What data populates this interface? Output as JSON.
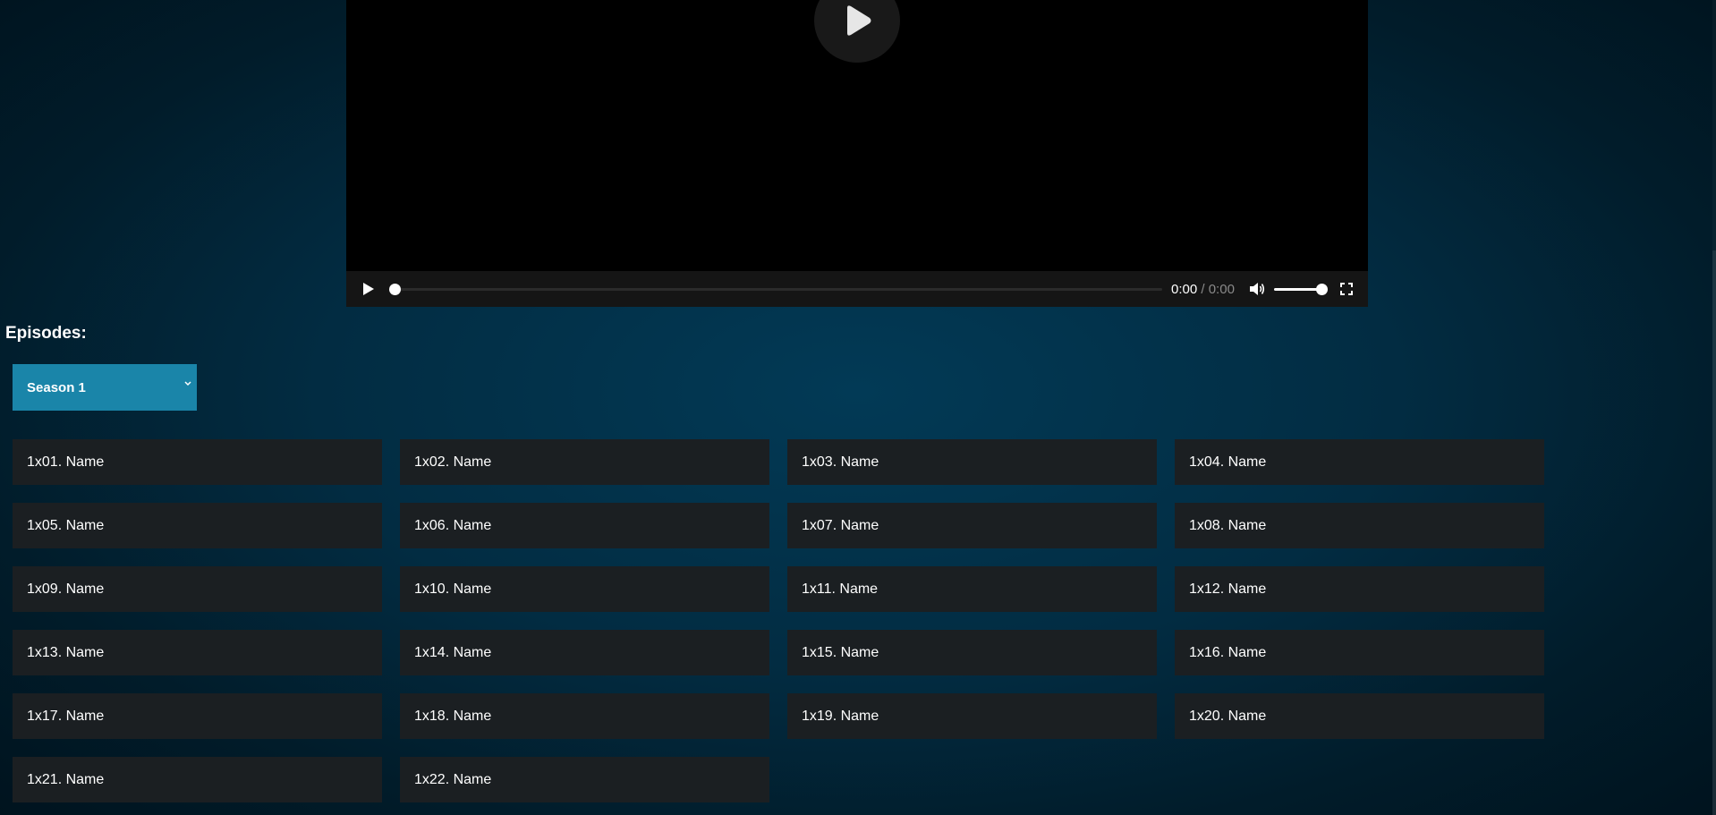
{
  "player": {
    "big_play_icon": "play-icon",
    "controls": {
      "play_icon": "play-icon",
      "progress_fraction": 0,
      "current_time": "0:00",
      "separator": "/",
      "duration": "0:00",
      "volume_icon": "volume-icon",
      "volume_fraction": 1,
      "fullscreen_icon": "fullscreen-icon"
    }
  },
  "episodes": {
    "heading": "Episodes:",
    "season_select": {
      "selected": "Season 1",
      "chevron_icon": "chevron-down-icon"
    },
    "list": [
      "1x01. Name",
      "1x02. Name",
      "1x03. Name",
      "1x04. Name",
      "1x05. Name",
      "1x06. Name",
      "1x07. Name",
      "1x08. Name",
      "1x09. Name",
      "1x10. Name",
      "1x11. Name",
      "1x12. Name",
      "1x13. Name",
      "1x14. Name",
      "1x15. Name",
      "1x16. Name",
      "1x17. Name",
      "1x18. Name",
      "1x19. Name",
      "1x20. Name",
      "1x21. Name",
      "1x22. Name"
    ]
  },
  "colors": {
    "season_select_bg": "#1a85a9",
    "episode_bg": "#1b1f22",
    "player_bg": "#000000",
    "controls_bg": "#151515"
  }
}
